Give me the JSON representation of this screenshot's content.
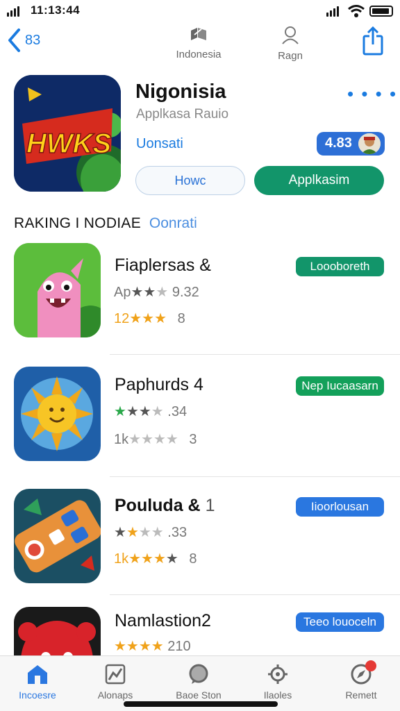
{
  "status_bar": {
    "time": "11:13:44"
  },
  "nav": {
    "back_label": "83",
    "item1_label": "Indonesia",
    "item2_label": "Ragn"
  },
  "hero": {
    "icon_text": "HWKS",
    "title": "Nigonisia",
    "subtitle": "Applkasa Rauio",
    "link": "Uonsati",
    "rating": "4.83",
    "more": "• • • •",
    "btn_secondary": "Howc",
    "btn_primary": "Applkasim"
  },
  "section": {
    "title": "RAKING I NODIAE",
    "link": "Oonrati"
  },
  "apps": [
    {
      "title": "Fiaplersas &",
      "line1_prefix": "Ap",
      "line1_stars": 2,
      "line1_value": "9.32",
      "line2_prefix": "12",
      "line2_stars": 3,
      "line2_value": "8",
      "button": "Loooboreth",
      "button_color": "#12956a"
    },
    {
      "title": "Paphurds 4",
      "line1_prefix": "",
      "line1_stars": 3,
      "line1_value": ".34",
      "line2_prefix": "1k",
      "line2_stars": 4,
      "line2_value": "3",
      "button": "Nep Iucaasarn",
      "button_color": "#13a05a"
    },
    {
      "title": "Pouluda &",
      "title_extra": "1",
      "line1_prefix": "",
      "line1_stars": 2,
      "line1_value": ".33",
      "line2_prefix": "1k",
      "line2_stars": 4,
      "line2_value": "8",
      "button": "Iioorlousan",
      "button_color": "#2a77e0"
    },
    {
      "title": "Namlastion2",
      "line1_prefix": "",
      "line1_stars": 4,
      "line1_value": "210",
      "button": "Teeo louoceln",
      "button_color": "#2a77e0"
    }
  ],
  "tabs": [
    {
      "label": "Incoesre"
    },
    {
      "label": "Alonaps"
    },
    {
      "label": "Baoe Ston"
    },
    {
      "label": "Ilaoles"
    },
    {
      "label": "Remett"
    }
  ],
  "colors": {
    "accent": "#1a7be0",
    "primary_green": "#12956a"
  }
}
